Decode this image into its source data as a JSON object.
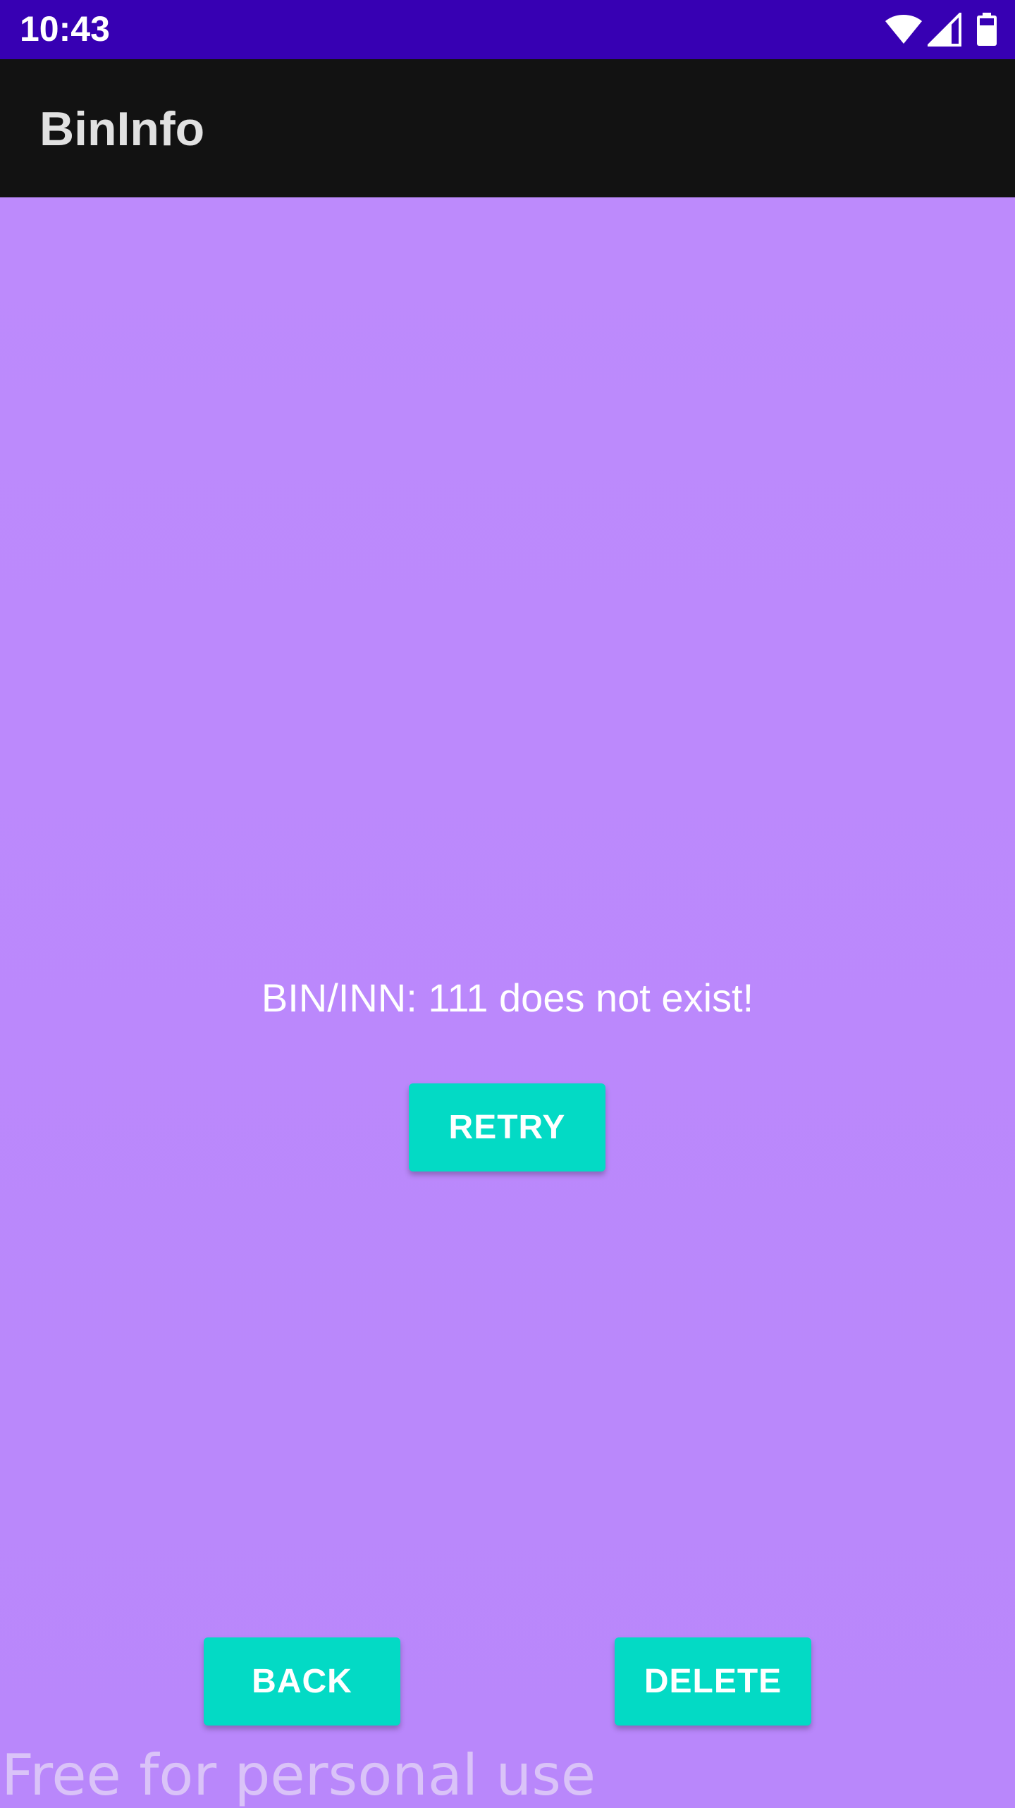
{
  "status_bar": {
    "time": "10:43",
    "icons": [
      "wifi-icon",
      "cellular-signal-icon",
      "battery-icon"
    ]
  },
  "app_bar": {
    "title": "BinInfo"
  },
  "main": {
    "message": "BIN/INN: 111 does not exist!",
    "retry_label": "RETRY"
  },
  "footer": {
    "back_label": "BACK",
    "delete_label": "DELETE"
  },
  "watermark": "Free for personal use",
  "colors": {
    "status_bar": "#3700B3",
    "app_bar": "#121212",
    "background": "#B987FB",
    "button": "#03DAC5"
  }
}
